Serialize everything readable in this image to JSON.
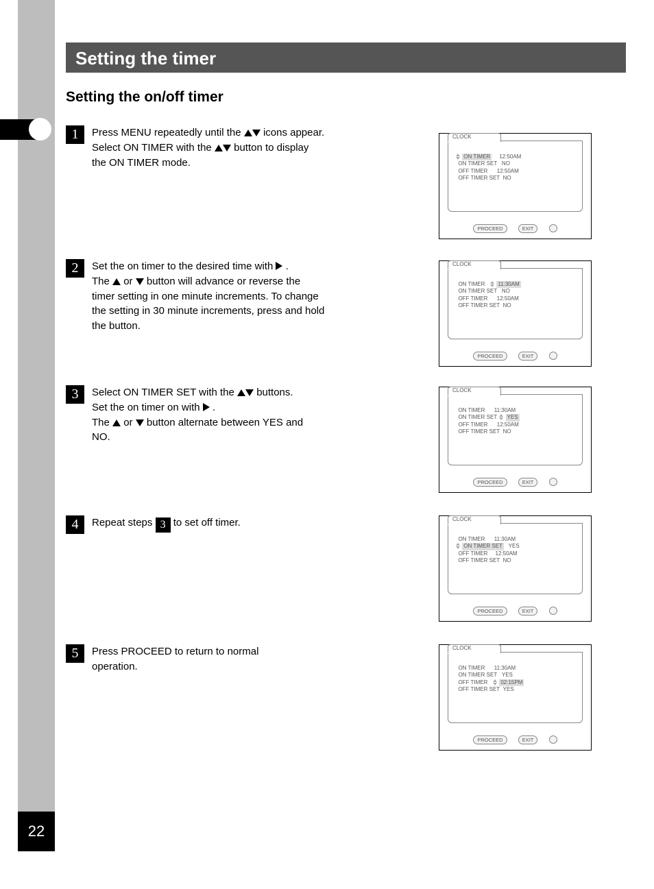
{
  "page_number": "22",
  "title": "Setting the timer",
  "subtitle": "Setting the on/off timer",
  "steps": {
    "s1": {
      "num": "1",
      "line1_a": "Press MENU repeatedly until the ",
      "line1_b": " icons appear.",
      "line2_a": "Select ON TIMER with the ",
      "line2_b": " button to display",
      "line3": "the ON TIMER mode."
    },
    "s2": {
      "num": "2",
      "line1_a": "Set the on timer to the desired time with ",
      "line1_b": ".",
      "line2_a": "The ",
      "line2_b": " or ",
      "line2_c": " button will advance or reverse the",
      "line3": "timer setting in one minute increments. To change",
      "line4": "the setting in 30 minute increments, press and hold",
      "line5": "the button."
    },
    "s3": {
      "num": "3",
      "line1_a": "Select ON TIMER SET with the ",
      "line1_b": " buttons.",
      "line2_a": "Set the on timer on with ",
      "line2_b": ".",
      "line3_a": "The ",
      "line3_b": " or ",
      "line3_c": " button alternate between YES and",
      "line4": "NO."
    },
    "s4": {
      "num": "4",
      "line1_a": "Repeat steps ",
      "ref": "3",
      "line1_b": " to set off timer."
    },
    "s5": {
      "num": "5",
      "line1": "Press PROCEED to return to normal",
      "line2": "operation."
    }
  },
  "osd": {
    "tab": "CLOCK",
    "btn_proceed": "PROCEED",
    "btn_exit": "EXIT",
    "generic_label_on_timer": "ON TIMER",
    "generic_label_on_timer_set": "ON TIMER SET",
    "generic_label_off_timer": "OFF TIMER",
    "generic_label_off_timer_set": "OFF TIMER SET",
    "val_no": "NO",
    "val_yes": "YES",
    "panel1": {
      "highlight": "ON TIMER",
      "time": "12:50AM",
      "row2a": "ON TIMER SET",
      "row2b": "NO",
      "row3a": "OFF TIMER",
      "row3b": "12:50AM",
      "row4a": "OFF TIMER SET",
      "row4b": "NO"
    },
    "panel2": {
      "row1a": "ON TIMER",
      "row1b_hi": "11:30AM",
      "row2a": "ON TIMER SET",
      "row2b": "NO",
      "row3a": "OFF TIMER",
      "row3b": "12:50AM",
      "row4a": "OFF TIMER SET",
      "row4b": "NO"
    },
    "panel3": {
      "row1a": "ON TIMER",
      "row1b": "11:30AM",
      "row2a": "ON TIMER SET",
      "row2b_hi": "YES",
      "row3a": "OFF TIMER",
      "row3b": "12:50AM",
      "row4a": "OFF TIMER SET",
      "row4b": "NO"
    },
    "panel4": {
      "row1a": "ON TIMER",
      "row1b": "11:30AM",
      "row2a": "OFF TIMER",
      "row2b": "12:50AM",
      "row3_hi": "ON TIMER SET",
      "row3b": "YES",
      "row4a": "OFF TIMER SET",
      "row4b": "NO"
    },
    "panel5": {
      "row1a": "ON TIMER",
      "row1b": "11:30AM",
      "row2a": "ON TIMER SET",
      "row2b": "YES",
      "row3a": "OFF TIMER",
      "row3b_hi": "02:15PM",
      "row4a": "OFF TIMER SET",
      "row4b": "YES"
    }
  }
}
